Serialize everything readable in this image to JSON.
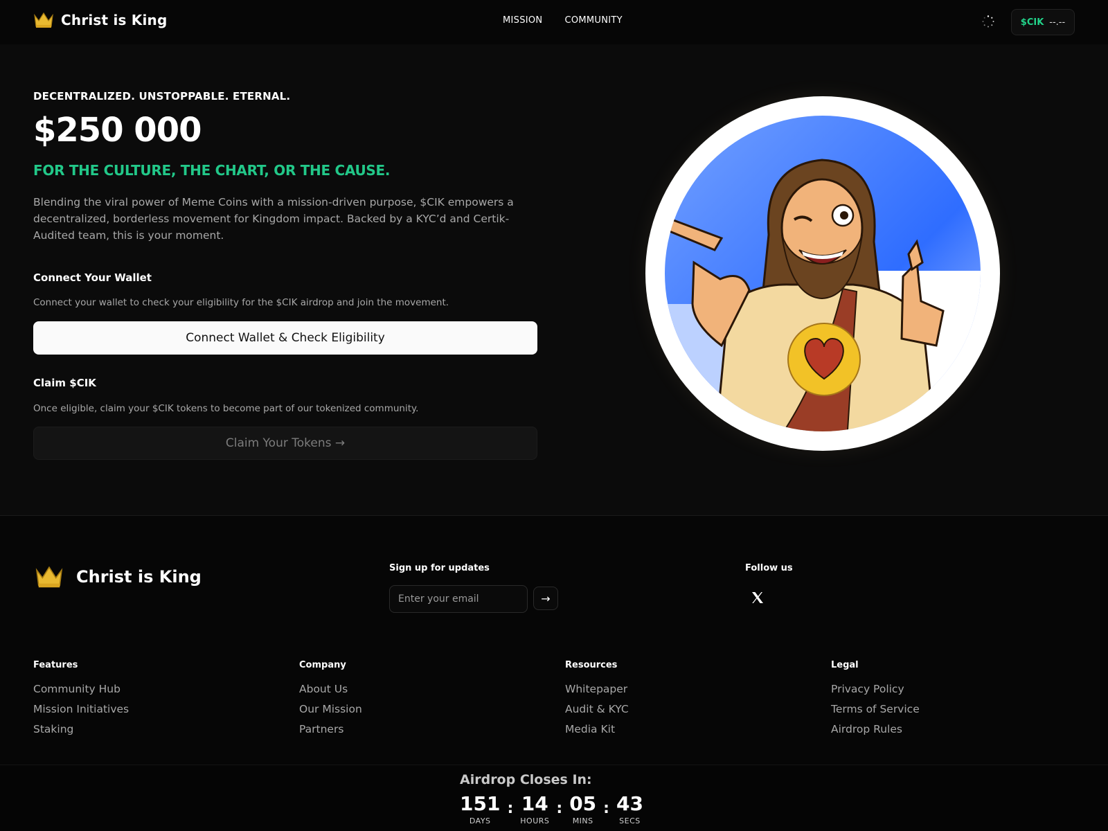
{
  "header": {
    "brand_name": "Christ is King",
    "nav": [
      "MISSION",
      "COMMUNITY"
    ],
    "ticker": "$CIK",
    "price": "--.--"
  },
  "hero": {
    "eyebrow": "DECENTRALIZED. UNSTOPPABLE. ETERNAL.",
    "amount": "$250 000",
    "tagline": "FOR THE CULTURE, THE CHART, OR THE CAUSE.",
    "description": "Blending the viral power of Meme Coins with a mission-driven purpose, $CIK empowers a decentralized, borderless movement for Kingdom impact. Backed by a KYC’d and Certik-Audited team, this is your moment.",
    "connect_title": "Connect Your Wallet",
    "connect_text": "Connect your wallet to check your eligibility for the $CIK airdrop and join the movement.",
    "connect_button": "Connect Wallet & Check Eligibility",
    "claim_title": "Claim $CIK",
    "claim_text": "Once eligible, claim your $CIK tokens to become part of our tokenized community.",
    "claim_button": "Claim Your Tokens →"
  },
  "colors": {
    "accent_green": "#22c889",
    "gold": "#e8b931",
    "blue": "#2f6dff"
  },
  "footer": {
    "brand_name": "Christ is King",
    "signup_label": "Sign up for updates",
    "email_placeholder": "Enter your email",
    "submit_arrow": "→",
    "follow_label": "Follow us",
    "columns": [
      {
        "title": "Features",
        "links": [
          "Community Hub",
          "Mission Initiatives",
          "Staking"
        ]
      },
      {
        "title": "Company",
        "links": [
          "About Us",
          "Our Mission",
          "Partners"
        ]
      },
      {
        "title": "Resources",
        "links": [
          "Whitepaper",
          "Audit & KYC",
          "Media Kit"
        ]
      },
      {
        "title": "Legal",
        "links": [
          "Privacy Policy",
          "Terms of Service",
          "Airdrop Rules"
        ]
      }
    ]
  },
  "countdown": {
    "title": "Airdrop Closes In:",
    "units": [
      {
        "value": "151",
        "label": "DAYS"
      },
      {
        "value": "14",
        "label": "HOURS"
      },
      {
        "value": "05",
        "label": "MINS"
      },
      {
        "value": "43",
        "label": "SECS"
      }
    ],
    "separator": ":"
  }
}
